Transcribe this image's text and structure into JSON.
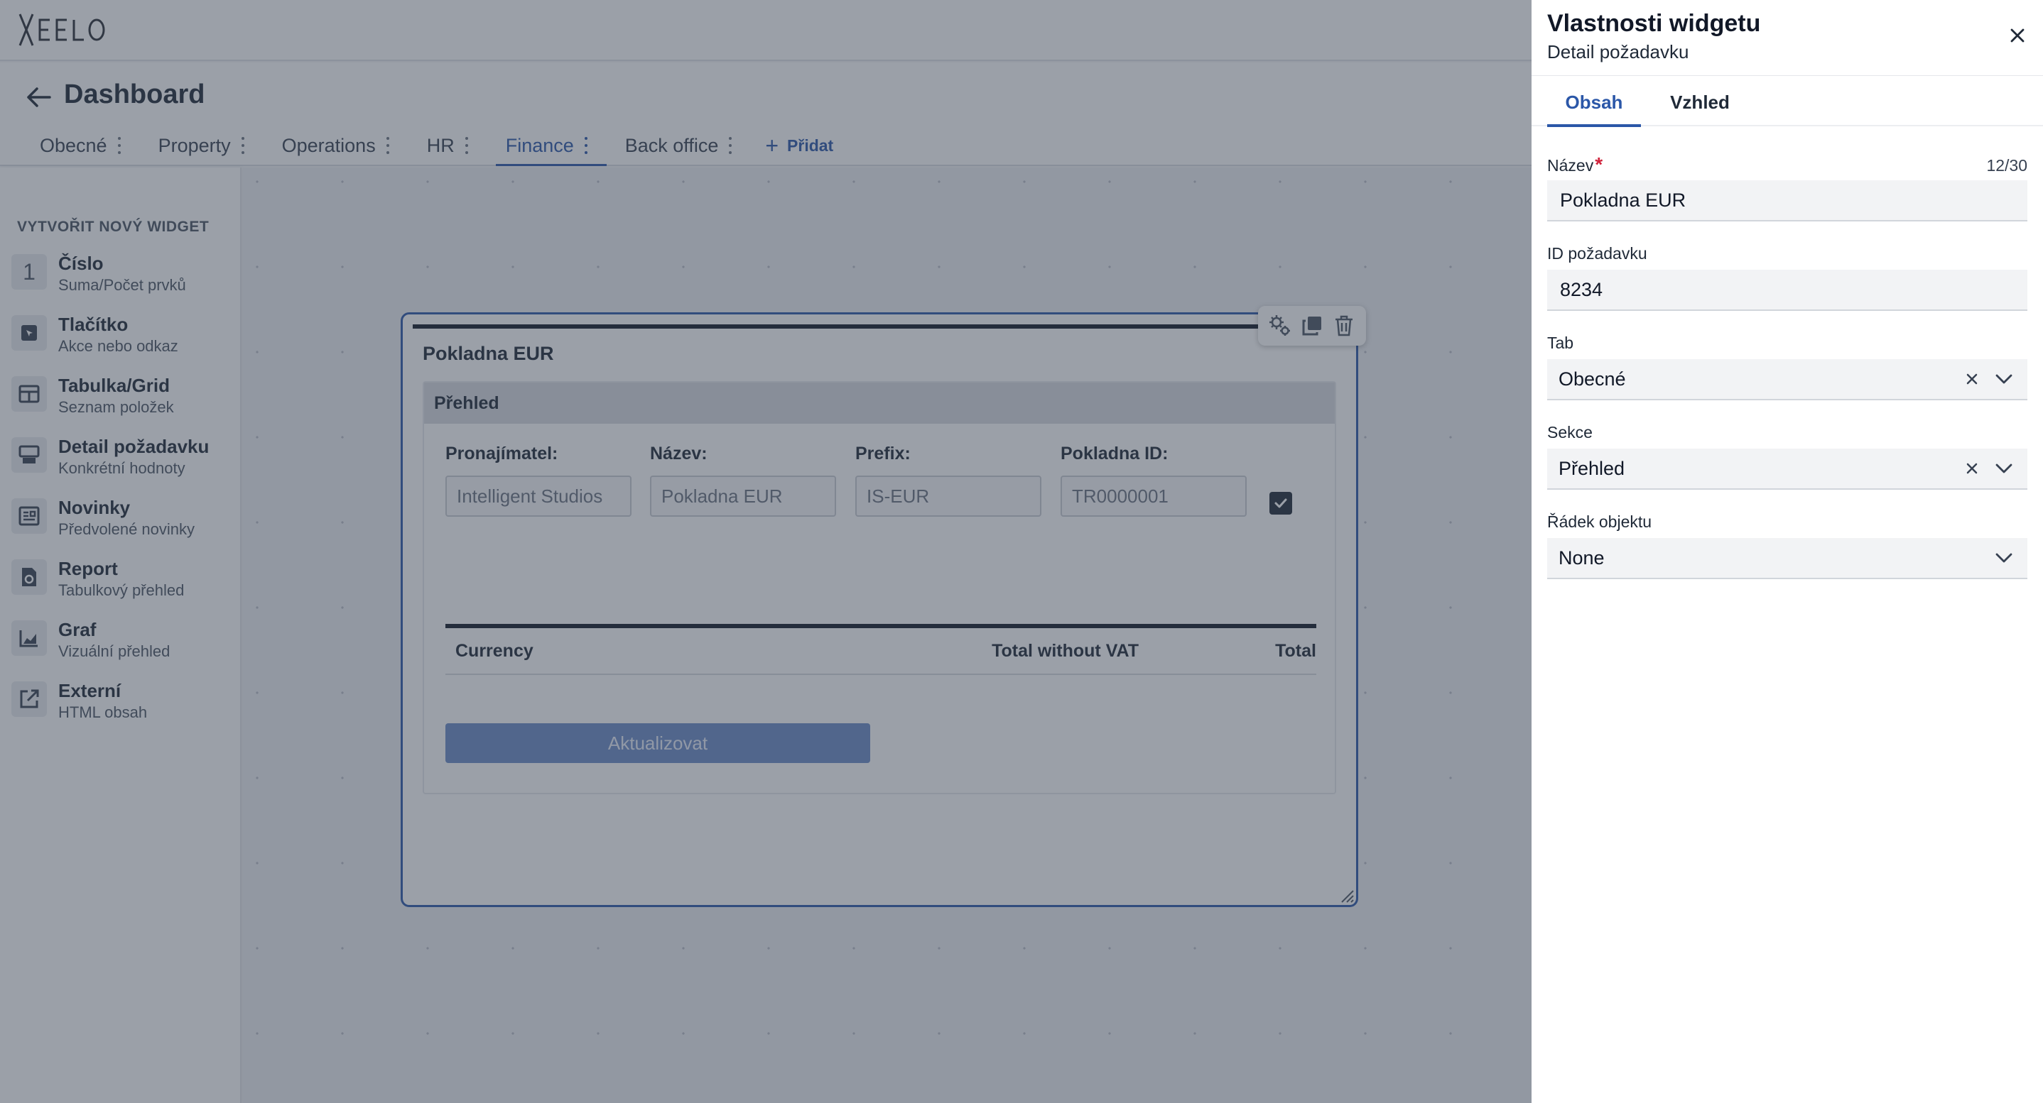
{
  "app": {
    "logo_text": "XEELO"
  },
  "header": {
    "title": "Dashboard",
    "tabs": [
      {
        "label": "Obecné"
      },
      {
        "label": "Property"
      },
      {
        "label": "Operations"
      },
      {
        "label": "HR"
      },
      {
        "label": "Finance",
        "active": true
      },
      {
        "label": "Back office"
      }
    ],
    "add_label": "Přidat"
  },
  "sidebar": {
    "title": "VYTVOŘIT NOVÝ WIDGET",
    "items": [
      {
        "name": "Číslo",
        "desc": "Suma/Počet prvků",
        "icon": "number-icon",
        "glyph": "1"
      },
      {
        "name": "Tlačítko",
        "desc": "Akce nebo odkaz",
        "icon": "button-icon"
      },
      {
        "name": "Tabulka/Grid",
        "desc": "Seznam položek",
        "icon": "table-icon"
      },
      {
        "name": "Detail požadavku",
        "desc": "Konkrétní hodnoty",
        "icon": "detail-icon"
      },
      {
        "name": "Novinky",
        "desc": "Předvolené novinky",
        "icon": "news-icon"
      },
      {
        "name": "Report",
        "desc": "Tabulkový přehled",
        "icon": "report-icon"
      },
      {
        "name": "Graf",
        "desc": "Vizuální přehled",
        "icon": "chart-icon"
      },
      {
        "name": "Externí",
        "desc": "HTML obsah",
        "icon": "external-link-icon"
      }
    ]
  },
  "widget": {
    "title": "Pokladna EUR",
    "section_title": "Přehled",
    "fields": [
      {
        "label": "Pronajímatel:",
        "value": "Intelligent Studios"
      },
      {
        "label": "Název:",
        "value": "Pokladna EUR"
      },
      {
        "label": "Prefix:",
        "value": "IS-EUR"
      },
      {
        "label": "Pokladna ID:",
        "value": "TR0000001"
      }
    ],
    "checkbox_checked": true,
    "table_columns": [
      "Currency",
      "Total without VAT",
      "Total"
    ],
    "update_button": "Aktualizovat"
  },
  "drawer": {
    "title": "Vlastnosti widgetu",
    "subtitle": "Detail požadavku",
    "tabs": [
      {
        "label": "Obsah",
        "active": true
      },
      {
        "label": "Vzhled"
      }
    ],
    "name_label": "Název",
    "name_required_mark": "*",
    "name_count": "12/30",
    "name_value": "Pokladna EUR",
    "id_label": "ID požadavku",
    "id_value": "8234",
    "tab_label": "Tab",
    "tab_value": "Obecné",
    "section_label": "Sekce",
    "section_value": "Přehled",
    "row_label": "Řádek objektu",
    "row_value": "None"
  },
  "colors": {
    "accent": "#2b57a8",
    "overlay": "#374151",
    "required": "#d0243c"
  }
}
